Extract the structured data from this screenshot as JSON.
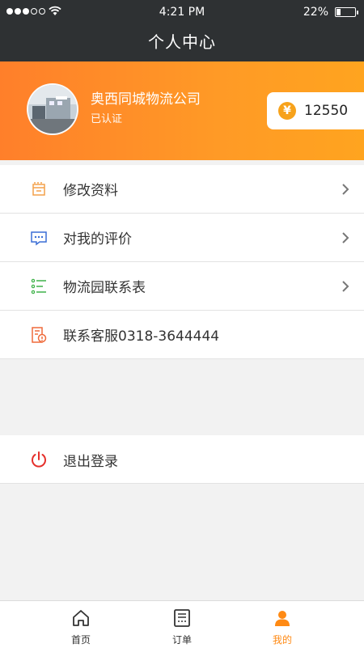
{
  "status_bar": {
    "time": "4:21 PM",
    "battery": "22%",
    "battery_level": 0.22
  },
  "header": {
    "title": "个人中心"
  },
  "profile": {
    "company": "奥西同城物流公司",
    "status": "已认证",
    "balance": "12550",
    "currency_icon": "yuan-icon"
  },
  "menu": [
    {
      "label": "修改资料",
      "icon": "edit-profile-icon"
    },
    {
      "label": "对我的评价",
      "icon": "comment-icon"
    },
    {
      "label": "物流园联系表",
      "icon": "list-icon"
    },
    {
      "label": "联系客服0318-3644444",
      "icon": "customer-service-icon"
    }
  ],
  "logout": {
    "label": "退出登录",
    "icon": "power-icon"
  },
  "tabs": [
    {
      "label": "首页",
      "icon": "home-icon"
    },
    {
      "label": "订单",
      "icon": "order-icon"
    },
    {
      "label": "我的",
      "icon": "user-icon",
      "active": true
    }
  ],
  "colors": {
    "accent": "#ff8a14",
    "header_bg": "#2e3133"
  }
}
